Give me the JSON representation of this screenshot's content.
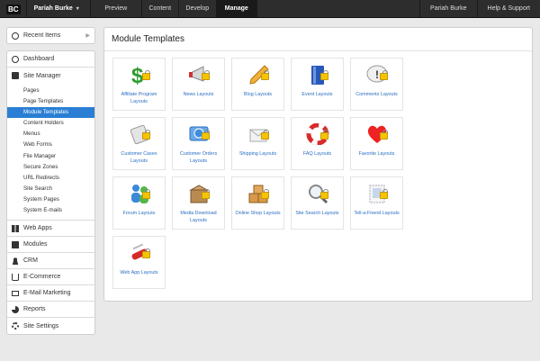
{
  "topbar": {
    "logo": "BC",
    "user": "Pariah Burke",
    "tabs": [
      {
        "label": "Preview"
      },
      {
        "label": "Content"
      },
      {
        "label": "Develop"
      },
      {
        "label": "Manage"
      }
    ],
    "right_links": [
      {
        "label": "Pariah Burke"
      },
      {
        "label": "Help & Support"
      }
    ]
  },
  "sidebar": {
    "recent_items": "Recent Items",
    "dashboard": "Dashboard",
    "site_manager": "Site Manager",
    "site_manager_items": [
      {
        "label": "Pages"
      },
      {
        "label": "Page Templates"
      },
      {
        "label": "Module Templates"
      },
      {
        "label": "Content Holders"
      },
      {
        "label": "Menus"
      },
      {
        "label": "Web Forms"
      },
      {
        "label": "File Manager"
      },
      {
        "label": "Secure Zones"
      },
      {
        "label": "URL Redirects"
      },
      {
        "label": "Site Search"
      },
      {
        "label": "System Pages"
      },
      {
        "label": "System E-mails"
      }
    ],
    "sections": [
      {
        "label": "Web Apps"
      },
      {
        "label": "Modules"
      },
      {
        "label": "CRM"
      },
      {
        "label": "E-Commerce"
      },
      {
        "label": "E-Mail Marketing"
      },
      {
        "label": "Reports"
      },
      {
        "label": "Site Settings"
      }
    ]
  },
  "main": {
    "title": "Module Templates",
    "tiles": [
      {
        "label": "Affiliate Program Layouts",
        "icon": "dollar-icon"
      },
      {
        "label": "News Layouts",
        "icon": "megaphone-icon"
      },
      {
        "label": "Blog Layouts",
        "icon": "pencil-icon"
      },
      {
        "label": "Event Layouts",
        "icon": "book-icon"
      },
      {
        "label": "Comments Layouts",
        "icon": "speech-bubble-icon"
      },
      {
        "label": "Customer Cases Layouts",
        "icon": "document-icon"
      },
      {
        "label": "Customer Orders Layouts",
        "icon": "globe-icon"
      },
      {
        "label": "Shipping Layouts",
        "icon": "envelope-icon"
      },
      {
        "label": "FAQ Layouts",
        "icon": "lifebuoy-icon"
      },
      {
        "label": "Favorite Layouts",
        "icon": "heart-icon"
      },
      {
        "label": "Forum Layouts",
        "icon": "people-icon"
      },
      {
        "label": "Media Download Layouts",
        "icon": "box-icon"
      },
      {
        "label": "Online Shop Layouts",
        "icon": "boxes-icon"
      },
      {
        "label": "Site Search Layouts",
        "icon": "magnifier-icon"
      },
      {
        "label": "Tell-a-Friend Layouts",
        "icon": "stamp-icon"
      },
      {
        "label": "Web App Layouts",
        "icon": "swiss-knife-icon"
      }
    ]
  }
}
